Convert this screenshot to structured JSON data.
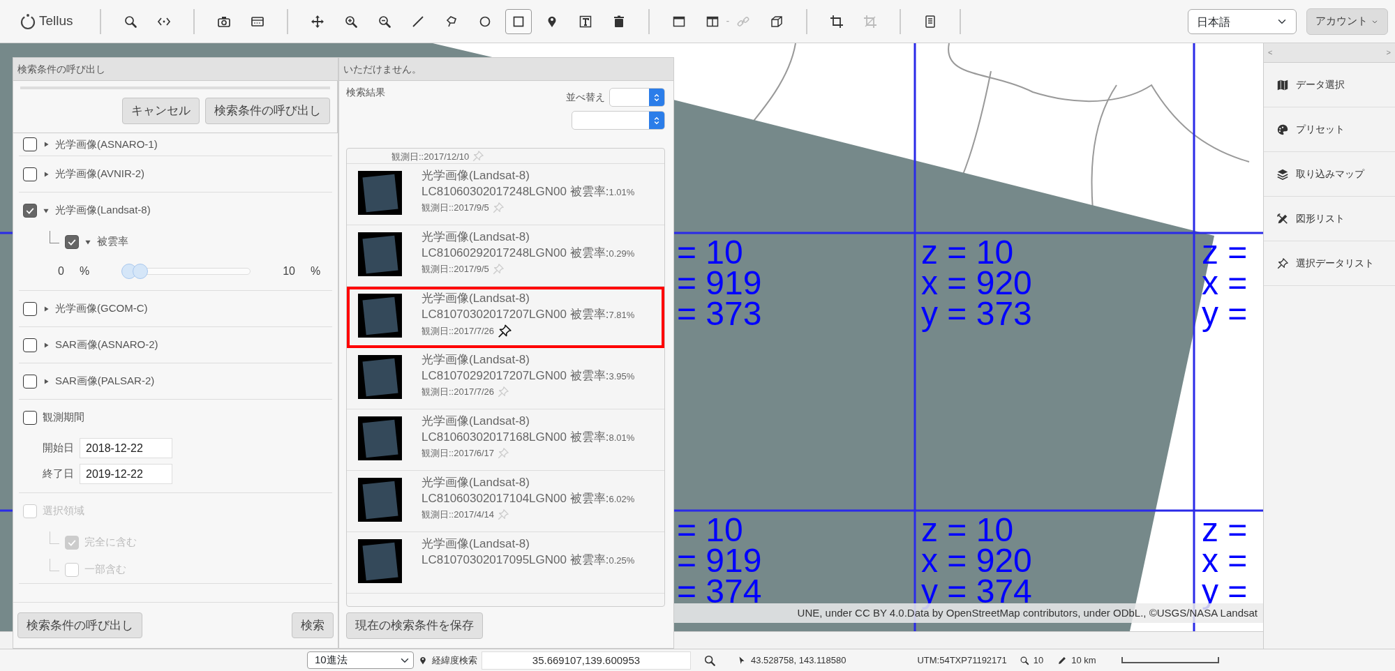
{
  "toolbar": {
    "logo": "Tellus",
    "groups": [
      [
        {
          "kind": "search",
          "selected": false,
          "disabled": false
        },
        {
          "kind": "code",
          "selected": false,
          "disabled": false
        }
      ],
      [
        {
          "kind": "camera",
          "selected": false,
          "disabled": false
        },
        {
          "kind": "panel",
          "selected": false,
          "disabled": false
        }
      ],
      [
        {
          "kind": "move",
          "selected": false,
          "disabled": false
        },
        {
          "kind": "zoom-in",
          "selected": false,
          "disabled": false
        },
        {
          "kind": "zoom-out",
          "selected": false,
          "disabled": false
        },
        {
          "kind": "line",
          "selected": false,
          "disabled": false
        },
        {
          "kind": "lasso",
          "selected": false,
          "disabled": false
        },
        {
          "kind": "circle",
          "selected": false,
          "disabled": false
        },
        {
          "kind": "square",
          "selected": true,
          "disabled": false
        },
        {
          "kind": "marker",
          "selected": false,
          "disabled": false
        },
        {
          "kind": "text-box",
          "selected": false,
          "disabled": false
        },
        {
          "kind": "trash",
          "selected": false,
          "disabled": false
        }
      ],
      [
        {
          "kind": "window",
          "selected": false,
          "disabled": false
        },
        {
          "kind": "split-window",
          "selected": false,
          "disabled": false
        },
        {
          "kind": "text",
          "label": "-"
        },
        {
          "kind": "link",
          "selected": false,
          "disabled": true
        },
        {
          "kind": "cube",
          "selected": false,
          "disabled": false
        }
      ],
      [
        {
          "kind": "crop",
          "selected": false,
          "disabled": false
        },
        {
          "kind": "crop-off",
          "selected": false,
          "disabled": true
        }
      ],
      [
        {
          "kind": "document",
          "selected": false,
          "disabled": false
        }
      ]
    ],
    "language": "日本語",
    "account": "アカウント"
  },
  "search_panel": {
    "dialog": {
      "title": "検索条件の呼び出し",
      "buttons": [
        "キャンセル",
        "検索条件の呼び出し"
      ]
    },
    "filters": [
      {
        "kind": "category",
        "label": "光学画像(ASNARO-1)",
        "checked": false,
        "expanded": false
      },
      {
        "kind": "category",
        "label": "光学画像(AVNIR-2)",
        "checked": false,
        "expanded": false
      },
      {
        "kind": "category",
        "label": "光学画像(Landsat-8)",
        "checked": true,
        "expanded": true,
        "children": [
          {
            "label": "被雲率",
            "checked": true,
            "expanded": true,
            "slider": {
              "min_value": "0",
              "min_unit": "%",
              "max_value": "10",
              "max_unit": "%",
              "low": {
                "level": 0
              },
              "high": {
                "level": 0.1
              }
            }
          }
        ]
      },
      {
        "kind": "category",
        "label": "光学画像(GCOM-C)",
        "checked": false,
        "expanded": false
      },
      {
        "kind": "category",
        "label": "SAR画像(ASNARO-2)",
        "checked": false,
        "expanded": false
      },
      {
        "kind": "category",
        "label": "SAR画像(PALSAR-2)",
        "checked": false,
        "expanded": false
      },
      {
        "kind": "period",
        "label": "観測期間",
        "checked": false,
        "fields": [
          {
            "label": "開始日",
            "value": "2018-12-22"
          },
          {
            "label": "終了日",
            "value": "2019-12-22"
          }
        ]
      },
      {
        "kind": "area",
        "label": "選択領域",
        "checked": false,
        "disabled": true,
        "children": [
          {
            "label": "完全に含む",
            "checked": true,
            "disabled": true
          },
          {
            "label": "一部含む",
            "checked": false,
            "disabled": true
          }
        ]
      }
    ],
    "footer_buttons": [
      "検索条件の呼び出し",
      "検索"
    ]
  },
  "results_panel": {
    "notice": "いただけません。",
    "title": "検索結果",
    "sort_label": "並べ替え",
    "items": [
      {
        "date": "観測日::2017/12/10",
        "selected": false
      },
      {
        "title": "光学画像(Landsat-8)",
        "id": "LC81060302017248LGN00",
        "cloud_label": "被雲率:",
        "cloud": "1.01%",
        "date": "観測日::2017/9/5",
        "selected": false
      },
      {
        "title": "光学画像(Landsat-8)",
        "id": "LC81060292017248LGN00",
        "cloud_label": "被雲率:",
        "cloud": "0.29%",
        "date": "観測日::2017/9/5",
        "selected": false
      },
      {
        "title": "光学画像(Landsat-8)",
        "id": "LC81070302017207LGN00",
        "cloud_label": "被雲率:",
        "cloud": "7.81%",
        "date": "観測日::2017/7/26",
        "selected": true
      },
      {
        "title": "光学画像(Landsat-8)",
        "id": "LC81070292017207LGN00",
        "cloud_label": "被雲率:",
        "cloud": "3.95%",
        "date": "観測日::2017/7/26",
        "selected": false
      },
      {
        "title": "光学画像(Landsat-8)",
        "id": "LC81060302017168LGN00",
        "cloud_label": "被雲率:",
        "cloud": "8.01%",
        "date": "観測日::2017/6/17",
        "selected": false
      },
      {
        "title": "光学画像(Landsat-8)",
        "id": "LC81060302017104LGN00",
        "cloud_label": "被雲率:",
        "cloud": "6.02%",
        "date": "観測日::2017/4/14",
        "selected": false
      },
      {
        "title": "光学画像(Landsat-8)",
        "id": "LC81070302017095LGN00",
        "cloud_label": "被雲率:",
        "cloud": "0.25%",
        "selected": false
      }
    ],
    "save_button": "現在の検索条件を保存"
  },
  "map": {
    "tiles": [
      {
        "lines": [
          "= 10",
          "= 919",
          "= 373"
        ]
      },
      {
        "lines": [
          "z = 10",
          "x = 920",
          "y = 373"
        ]
      },
      {
        "lines": [
          "z =",
          "x =",
          "y ="
        ]
      },
      {
        "lines": [
          "= 10",
          "= 919",
          "= 374"
        ]
      },
      {
        "lines": [
          "z = 10",
          "x = 920",
          "y = 374"
        ]
      },
      {
        "lines": [
          "z =",
          "x =",
          "y ="
        ]
      }
    ],
    "attribution": "UNE, under CC BY 4.0.Data by OpenStreetMap contributors, under ODbL., ©USGS/NASA Landsat"
  },
  "sidebar": {
    "collapse": [
      "<",
      ">"
    ],
    "items": [
      {
        "kind": "map",
        "label": "データ選択"
      },
      {
        "kind": "palette",
        "label": "プリセット"
      },
      {
        "kind": "layers",
        "label": "取り込みマップ"
      },
      {
        "kind": "tools",
        "label": "図形リスト"
      },
      {
        "kind": "pin",
        "label": "選択データリスト"
      }
    ]
  },
  "status_bar": {
    "format": "10進法",
    "coord_label": "経緯度検索",
    "coord_value": "35.669107,139.600953",
    "cursor": "43.528758, 143.118580",
    "utm": "UTM:54TXP71192171",
    "zoom": "10",
    "scale": "10 km"
  }
}
